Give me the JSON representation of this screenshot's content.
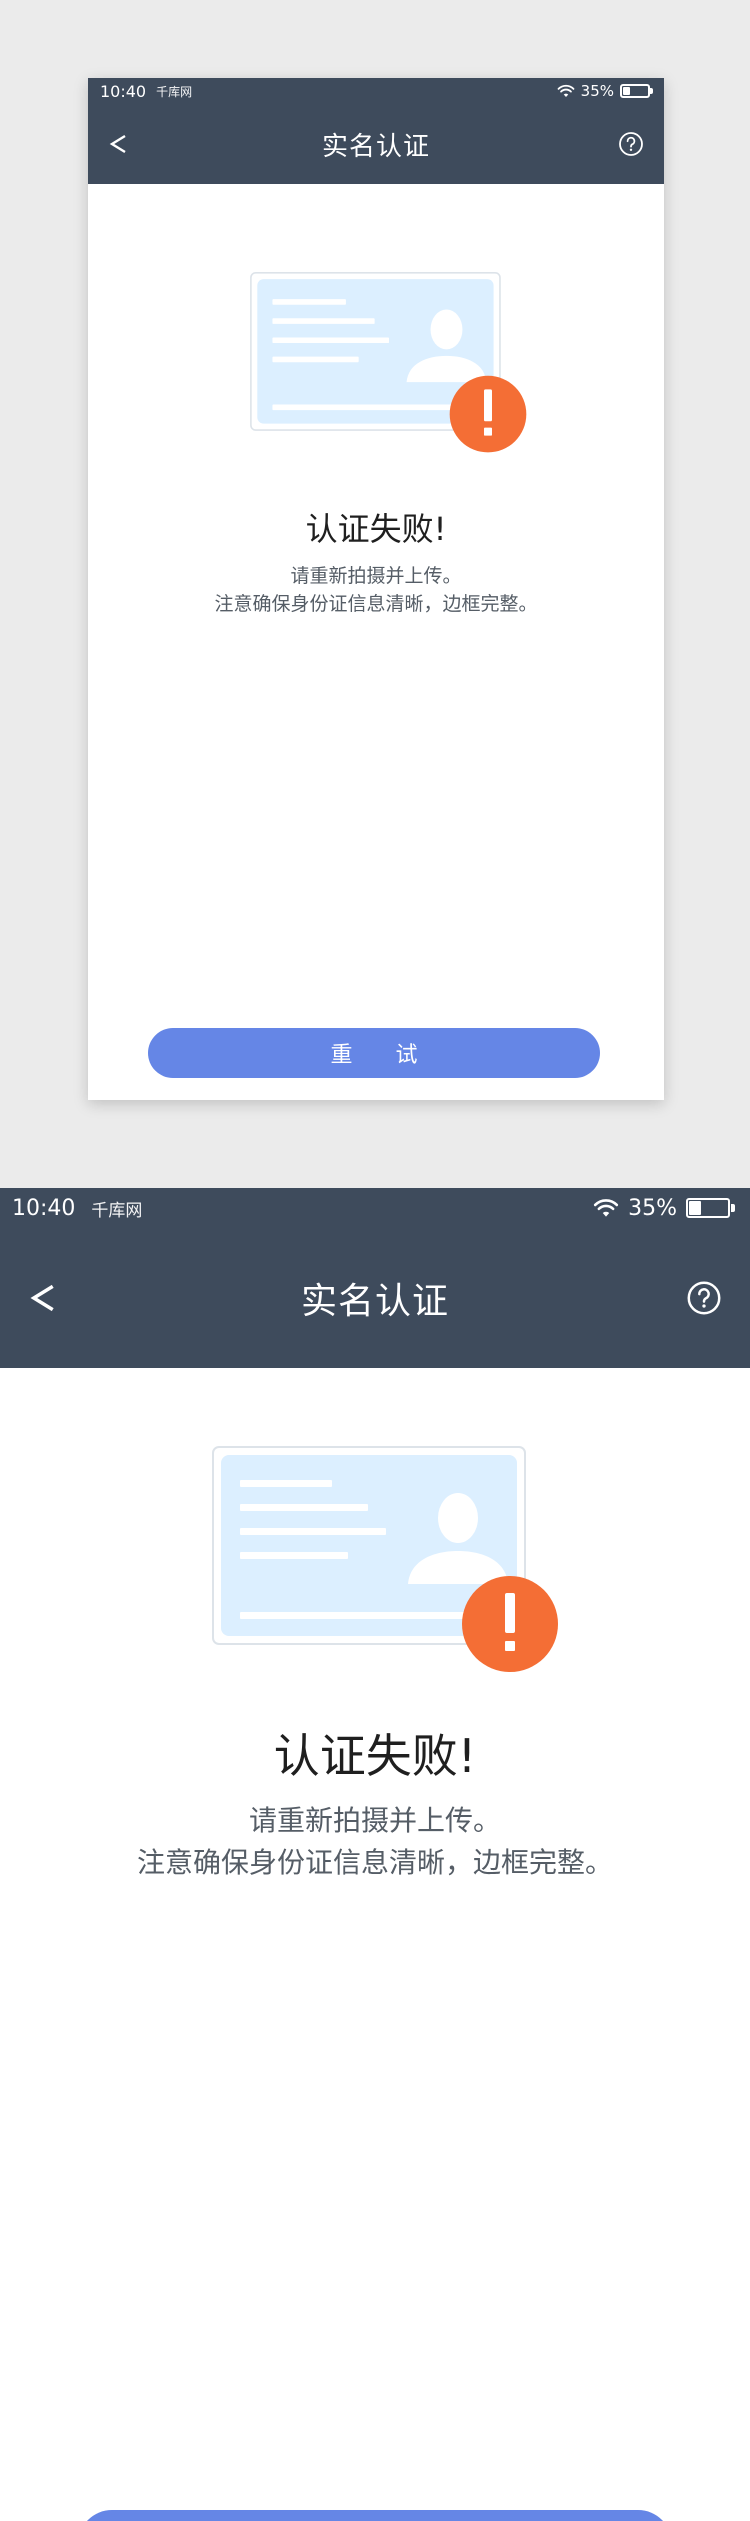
{
  "status_bar": {
    "time": "10:40",
    "carrier": "千库网",
    "battery_text": "35%",
    "battery_level": 0.35
  },
  "nav": {
    "title": "实名认证",
    "back_glyph": "<",
    "back_icon": "chevron-left-icon",
    "help_icon": "question-circle-icon"
  },
  "result": {
    "title": "认证失败!",
    "line1": "请重新拍摄并上传。",
    "line2": "注意确保身份证信息清晰，边框完整。",
    "warning_icon": "exclamation-circle-icon"
  },
  "retry_button": {
    "label": "重 试"
  },
  "colors": {
    "header_bg": "#3e4b5c",
    "accent": "#6586e6",
    "warning": "#f46e35",
    "card_bg": "#dcefff",
    "page_bg": "#ebebeb"
  }
}
